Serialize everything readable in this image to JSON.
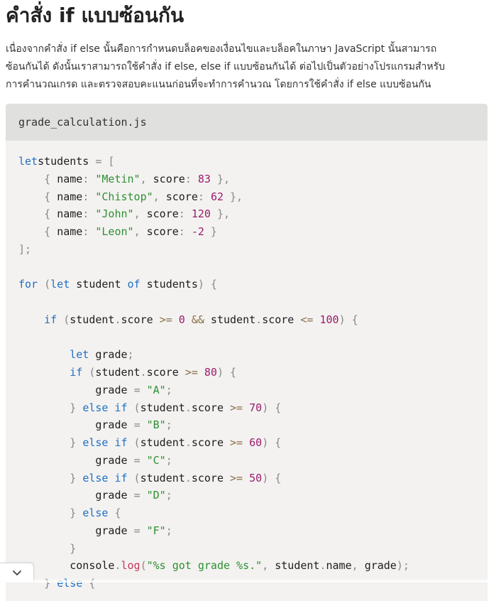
{
  "article": {
    "heading": "คำสั่ง if แบบซ้อนกัน",
    "intro_lines": [
      "เนื่องจากคำสั่ง if else นั้นคือการกำหนดบล็อคของเงื่อนไขและบล็อคในภาษา JavaScript นั้นสามารถ",
      "ซ้อนกันได้ ดังนั้นเราสามารถใช้คำสั่ง if else, else if แบบซ้อนกันได้ ต่อไปเป็นตัวอย่างโปรแกรมสำหรับ",
      "การคำนวณเกรด และตรวจสอบคะแนนก่อนที่จะทำการคำนวณ โดยการใช้คำสั่ง if else แบบซ้อนกัน"
    ]
  },
  "code_block": {
    "filename": "grade_calculation.js",
    "lines": [
      [
        [
          "k",
          "let"
        ],
        [
          "",
          "students"
        ],
        [
          "p",
          " = ["
        ]
      ],
      [
        [
          "p",
          "    { "
        ],
        [
          "",
          "name"
        ],
        [
          "p",
          ": "
        ],
        [
          "s",
          "\"Metin\""
        ],
        [
          "p",
          ", "
        ],
        [
          "",
          "score"
        ],
        [
          "p",
          ": "
        ],
        [
          "n",
          "83"
        ],
        [
          "p",
          " },"
        ]
      ],
      [
        [
          "p",
          "    { "
        ],
        [
          "",
          "name"
        ],
        [
          "p",
          ": "
        ],
        [
          "s",
          "\"Chistop\""
        ],
        [
          "p",
          ", "
        ],
        [
          "",
          "score"
        ],
        [
          "p",
          ": "
        ],
        [
          "n",
          "62"
        ],
        [
          "p",
          " },"
        ]
      ],
      [
        [
          "p",
          "    { "
        ],
        [
          "",
          "name"
        ],
        [
          "p",
          ": "
        ],
        [
          "s",
          "\"John\""
        ],
        [
          "p",
          ", "
        ],
        [
          "",
          "score"
        ],
        [
          "p",
          ": "
        ],
        [
          "n",
          "120"
        ],
        [
          "p",
          " },"
        ]
      ],
      [
        [
          "p",
          "    { "
        ],
        [
          "",
          "name"
        ],
        [
          "p",
          ": "
        ],
        [
          "s",
          "\"Leon\""
        ],
        [
          "p",
          ", "
        ],
        [
          "",
          "score"
        ],
        [
          "p",
          ": "
        ],
        [
          "n",
          "-2"
        ],
        [
          "p",
          " }"
        ]
      ],
      [
        [
          "p",
          "];"
        ]
      ],
      [],
      [
        [
          "k",
          "for"
        ],
        [
          "p",
          " ("
        ],
        [
          "k",
          "let"
        ],
        [
          "",
          " student "
        ],
        [
          "k",
          "of"
        ],
        [
          "",
          " students"
        ],
        [
          "p",
          ") {"
        ]
      ],
      [],
      [
        [
          "",
          "    "
        ],
        [
          "k",
          "if"
        ],
        [
          "p",
          " ("
        ],
        [
          "",
          "student"
        ],
        [
          "p",
          "."
        ],
        [
          "",
          "score "
        ],
        [
          "o",
          ">="
        ],
        [
          "",
          " "
        ],
        [
          "n",
          "0"
        ],
        [
          "",
          " "
        ],
        [
          "o",
          "&&"
        ],
        [
          "",
          " student"
        ],
        [
          "p",
          "."
        ],
        [
          "",
          "score "
        ],
        [
          "o",
          "<="
        ],
        [
          "",
          " "
        ],
        [
          "n",
          "100"
        ],
        [
          "p",
          ") {"
        ]
      ],
      [],
      [
        [
          "",
          "        "
        ],
        [
          "k",
          "let"
        ],
        [
          "",
          " grade"
        ],
        [
          "p",
          ";"
        ]
      ],
      [
        [
          "",
          "        "
        ],
        [
          "k",
          "if"
        ],
        [
          "p",
          " ("
        ],
        [
          "",
          "student"
        ],
        [
          "p",
          "."
        ],
        [
          "",
          "score "
        ],
        [
          "o",
          ">="
        ],
        [
          "",
          " "
        ],
        [
          "n",
          "80"
        ],
        [
          "p",
          ") {"
        ]
      ],
      [
        [
          "",
          "            grade "
        ],
        [
          "p",
          "= "
        ],
        [
          "s",
          "\"A\""
        ],
        [
          "p",
          ";"
        ]
      ],
      [
        [
          "p",
          "        } "
        ],
        [
          "k",
          "else if"
        ],
        [
          "p",
          " ("
        ],
        [
          "",
          "student"
        ],
        [
          "p",
          "."
        ],
        [
          "",
          "score "
        ],
        [
          "o",
          ">="
        ],
        [
          "",
          " "
        ],
        [
          "n",
          "70"
        ],
        [
          "p",
          ") {"
        ]
      ],
      [
        [
          "",
          "            grade "
        ],
        [
          "p",
          "= "
        ],
        [
          "s",
          "\"B\""
        ],
        [
          "p",
          ";"
        ]
      ],
      [
        [
          "p",
          "        } "
        ],
        [
          "k",
          "else if"
        ],
        [
          "p",
          " ("
        ],
        [
          "",
          "student"
        ],
        [
          "p",
          "."
        ],
        [
          "",
          "score "
        ],
        [
          "o",
          ">="
        ],
        [
          "",
          " "
        ],
        [
          "n",
          "60"
        ],
        [
          "p",
          ") {"
        ]
      ],
      [
        [
          "",
          "            grade "
        ],
        [
          "p",
          "= "
        ],
        [
          "s",
          "\"C\""
        ],
        [
          "p",
          ";"
        ]
      ],
      [
        [
          "p",
          "        } "
        ],
        [
          "k",
          "else if"
        ],
        [
          "p",
          " ("
        ],
        [
          "",
          "student"
        ],
        [
          "p",
          "."
        ],
        [
          "",
          "score "
        ],
        [
          "o",
          ">="
        ],
        [
          "",
          " "
        ],
        [
          "n",
          "50"
        ],
        [
          "p",
          ") {"
        ]
      ],
      [
        [
          "",
          "            grade "
        ],
        [
          "p",
          "= "
        ],
        [
          "s",
          "\"D\""
        ],
        [
          "p",
          ";"
        ]
      ],
      [
        [
          "p",
          "        } "
        ],
        [
          "k",
          "else"
        ],
        [
          "p",
          " {"
        ]
      ],
      [
        [
          "",
          "            grade "
        ],
        [
          "p",
          "= "
        ],
        [
          "s",
          "\"F\""
        ],
        [
          "p",
          ";"
        ]
      ],
      [
        [
          "p",
          "        }"
        ]
      ],
      [
        [
          "",
          "        console"
        ],
        [
          "p",
          "."
        ],
        [
          "f",
          "log"
        ],
        [
          "p",
          "("
        ],
        [
          "s",
          "\"%s got grade %s.\""
        ],
        [
          "p",
          ", "
        ],
        [
          "",
          "student"
        ],
        [
          "p",
          "."
        ],
        [
          "",
          "name"
        ],
        [
          "p",
          ", "
        ],
        [
          "",
          "grade"
        ],
        [
          "p",
          ");"
        ]
      ],
      [
        [
          "p",
          "    } "
        ],
        [
          "k",
          "else"
        ],
        [
          "p",
          " {"
        ]
      ]
    ]
  },
  "controls": {
    "collapse_icon": "chevron-down-icon"
  },
  "colors": {
    "keyword": "#1f6fc5",
    "string": "#2f8f33",
    "number": "#9b1b6b",
    "punctuation": "#888888",
    "operator": "#8a6d47",
    "function": "#c7375a",
    "code_background": "#f3f2f0",
    "code_header_background": "#e0e0df"
  }
}
